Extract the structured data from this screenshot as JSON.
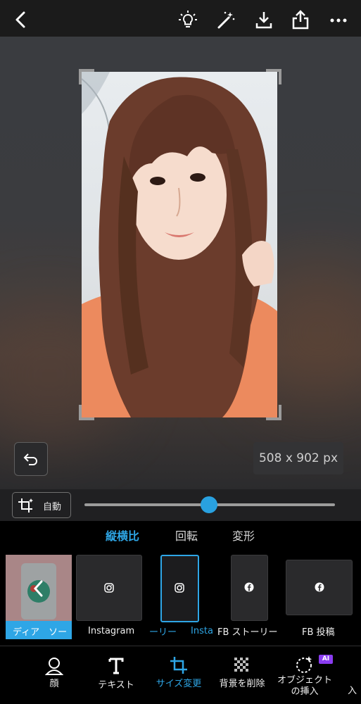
{
  "topbar": {
    "back_icon": "chevron-left-icon",
    "icons": [
      "lightbulb-icon",
      "magic-wand-icon",
      "download-icon",
      "share-icon",
      "more-icon"
    ]
  },
  "canvas": {
    "dimensions": "508 x 902 px"
  },
  "controls": {
    "auto_label": "自動",
    "slider_value": 0.5
  },
  "tabs": [
    {
      "label": "縦横比",
      "active": true
    },
    {
      "label": "回転",
      "active": false
    },
    {
      "label": "変形",
      "active": false
    }
  ],
  "presets": [
    {
      "label": "ディア　ソー",
      "icon": "chevron-left-icon"
    },
    {
      "label": "Instagram",
      "icon": "instagram-icon"
    },
    {
      "label": "ーリー",
      "icon": "instagram-icon",
      "selected": true
    },
    {
      "label": "Instag",
      "icon": ""
    },
    {
      "label": "FB ストーリー",
      "icon": "facebook-icon"
    },
    {
      "label": "FB 投稿",
      "icon": "facebook-icon"
    }
  ],
  "bottom_nav": [
    {
      "label": "顔",
      "icon": "face-icon"
    },
    {
      "label": "テキスト",
      "icon": "text-icon"
    },
    {
      "label": "サイズ変更",
      "icon": "crop-icon",
      "active": true
    },
    {
      "label": "背景を削除",
      "icon": "remove-background-icon"
    },
    {
      "label": "オブジェクト\nの挿入",
      "icon": "insert-object-icon",
      "badge": "AI"
    },
    {
      "label": "入",
      "icon": ""
    }
  ],
  "colors": {
    "accent": "#2ea6e6",
    "ai_badge": "#8a3cf0"
  }
}
